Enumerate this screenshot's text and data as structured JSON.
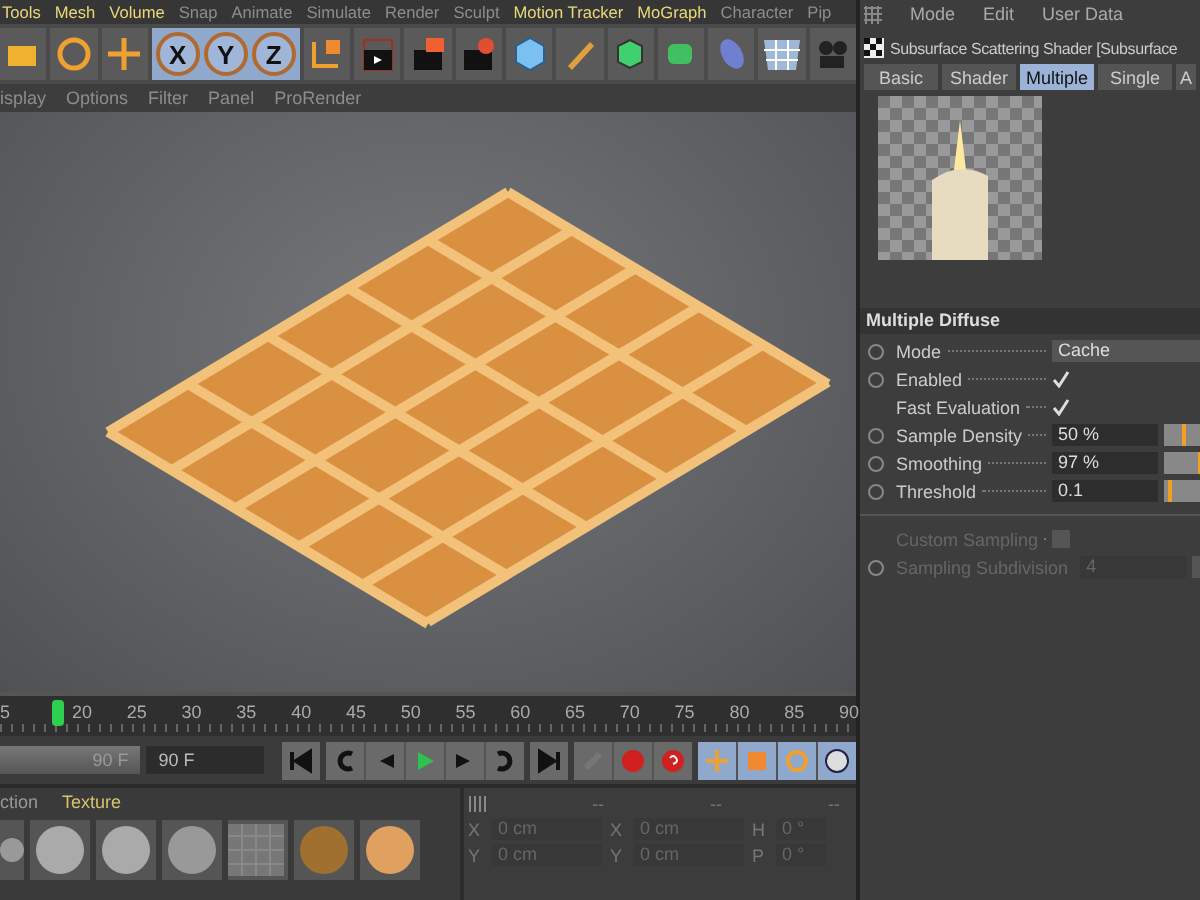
{
  "main_menu": [
    {
      "label": "Tools",
      "highlighted": true
    },
    {
      "label": "Mesh",
      "highlighted": true
    },
    {
      "label": "Volume",
      "highlighted": true
    },
    {
      "label": "Snap",
      "highlighted": false
    },
    {
      "label": "Animate",
      "highlighted": false
    },
    {
      "label": "Simulate",
      "highlighted": false
    },
    {
      "label": "Render",
      "highlighted": false
    },
    {
      "label": "Sculpt",
      "highlighted": false
    },
    {
      "label": "Motion Tracker",
      "highlighted": true
    },
    {
      "label": "MoGraph",
      "highlighted": true
    },
    {
      "label": "Character",
      "highlighted": false
    },
    {
      "label": "Pip",
      "highlighted": false
    }
  ],
  "toolbar": {
    "axis_buttons": [
      {
        "label": "X",
        "selected": true
      },
      {
        "label": "Y",
        "selected": true
      },
      {
        "label": "Z",
        "selected": true
      }
    ]
  },
  "viewport_menu": [
    "isplay",
    "Options",
    "Filter",
    "Panel",
    "ProRender"
  ],
  "timeline": {
    "ticks": [
      "5",
      "20",
      "25",
      "30",
      "35",
      "40",
      "45",
      "50",
      "55",
      "60",
      "65",
      "70",
      "75",
      "80",
      "85",
      "90"
    ],
    "range_slider": {
      "value": "90 F",
      "level": 1
    },
    "end_field": "90 F"
  },
  "materials": {
    "tabs": [
      {
        "label": "ction",
        "selected": false
      },
      {
        "label": "Texture",
        "selected": true
      }
    ]
  },
  "coordinates": {
    "headers": [
      "--",
      "--",
      "--"
    ],
    "rows": [
      {
        "axis": "X",
        "position": "0 cm",
        "size_axis": "X",
        "size": "0 cm",
        "rot_axis": "H",
        "rotation": "0 °"
      },
      {
        "axis": "Y",
        "position": "0 cm",
        "size_axis": "Y",
        "size": "0 cm",
        "rot_axis": "P",
        "rotation": "0 °"
      }
    ]
  },
  "attributes": {
    "menu": [
      "Mode",
      "Edit",
      "User Data"
    ],
    "title": "Subsurface Scattering Shader [Subsurface",
    "tabs": [
      {
        "label": "Basic",
        "selected": false
      },
      {
        "label": "Shader",
        "selected": false
      },
      {
        "label": "Multiple",
        "selected": true
      },
      {
        "label": "Single",
        "selected": false
      },
      {
        "label": "A",
        "selected": false
      }
    ],
    "section": "Multiple Diffuse",
    "params": [
      {
        "kind": "dropdown",
        "label": "Mode",
        "value": "Cache",
        "animatable": true,
        "disabled": false
      },
      {
        "kind": "checkbox",
        "label": "Enabled",
        "checked": true,
        "animatable": true,
        "disabled": false
      },
      {
        "kind": "checkbox",
        "label": "Fast Evaluation",
        "checked": true,
        "animatable": false,
        "disabled": false
      },
      {
        "kind": "slider",
        "label": "Sample Density",
        "value": "50 %",
        "level": 0.5,
        "animatable": true,
        "disabled": false
      },
      {
        "kind": "slider",
        "label": "Smoothing",
        "value": "97 %",
        "level": 0.97,
        "animatable": true,
        "disabled": false
      },
      {
        "kind": "slider",
        "label": "Threshold",
        "value": "0.1",
        "level": 0.1,
        "animatable": true,
        "disabled": false
      },
      {
        "kind": "separator"
      },
      {
        "kind": "checkbox",
        "label": "Custom Sampling",
        "checked": false,
        "animatable": false,
        "disabled": true
      },
      {
        "kind": "slider",
        "label": "Sampling Subdivision",
        "value": "4",
        "animatable": true,
        "disabled": true
      }
    ]
  }
}
